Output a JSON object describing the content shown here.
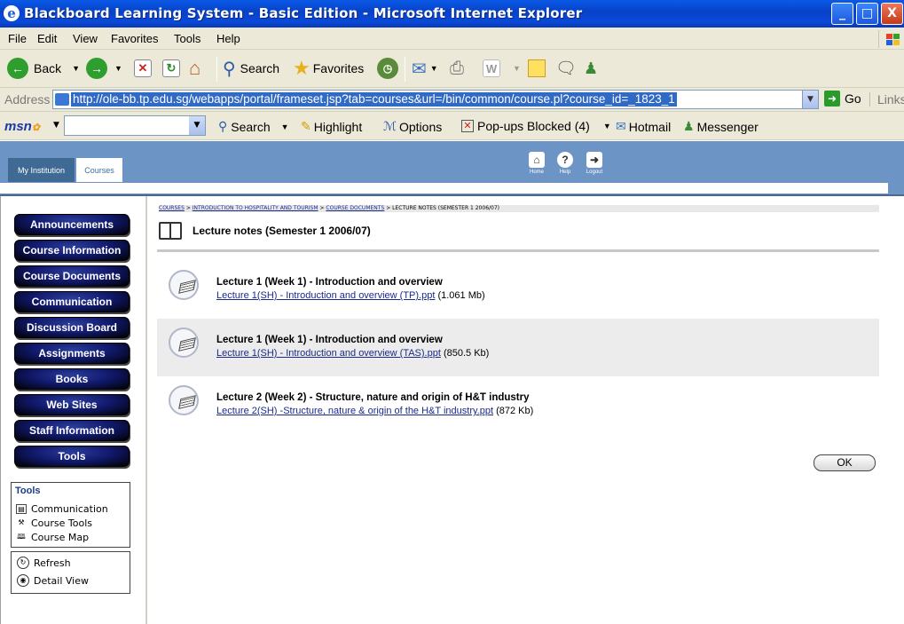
{
  "window": {
    "title": "Blackboard Learning System - Basic Edition - Microsoft Internet Explorer",
    "min": "_",
    "max": "□",
    "close": "X"
  },
  "menu": [
    "File",
    "Edit",
    "View",
    "Favorites",
    "Tools",
    "Help"
  ],
  "toolbar": {
    "back": "Back",
    "search": "Search",
    "favorites": "Favorites"
  },
  "address": {
    "label": "Address",
    "url": "http://ole-bb.tp.edu.sg/webapps/portal/frameset.jsp?tab=courses&url=/bin/common/course.pl?course_id=_1823_1",
    "go": "Go",
    "links": "Links"
  },
  "msn": {
    "logo": "msn",
    "search": "Search",
    "highlight": "Highlight",
    "options": "Options",
    "popups": "Pop-ups Blocked (4)",
    "hotmail": "Hotmail",
    "messenger": "Messenger"
  },
  "bb": {
    "tabs": {
      "institution": "My Institution",
      "courses": "Courses"
    },
    "header_icons": {
      "home": "Home",
      "help": "Help",
      "logout": "Logout"
    }
  },
  "nav": [
    "Announcements",
    "Course Information",
    "Course Documents",
    "Communication",
    "Discussion Board",
    "Assignments",
    "Books",
    "Web Sites",
    "Staff Information",
    "Tools"
  ],
  "tools_box": {
    "heading": "Tools",
    "items": [
      "Communication",
      "Course Tools",
      "Course Map"
    ]
  },
  "view_box": {
    "items": [
      "Refresh",
      "Detail View"
    ]
  },
  "breadcrumb": {
    "courses": "COURSES",
    "course": "INTRODUCTION TO HOSPITALITY AND TOURISM",
    "documents": "COURSE DOCUMENTS",
    "current": "LECTURE NOTES (SEMESTER 1 2006/07)",
    "sep": ">"
  },
  "page_title": "Lecture notes (Semester 1 2006/07)",
  "items": [
    {
      "title": "Lecture 1 (Week 1) - Introduction and overview",
      "file": "Lecture 1(SH) - Introduction and overview (TP).ppt",
      "size": "(1.061 Mb)"
    },
    {
      "title": "Lecture 1 (Week 1) - Introduction and overview",
      "file": "Lecture 1(SH) - Introduction and overview (TAS).ppt",
      "size": "(850.5 Kb)"
    },
    {
      "title": "Lecture 2 (Week 2) - Structure, nature and origin of H&T industry",
      "file": "Lecture 2(SH) -Structure, nature & origin of the H&T industry.ppt",
      "size": "(872 Kb)"
    }
  ],
  "ok_label": "OK"
}
